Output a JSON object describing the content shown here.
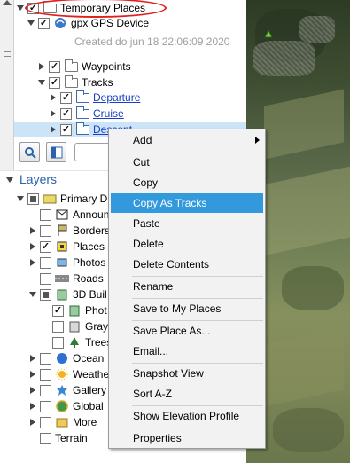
{
  "places": {
    "temporary": "Temporary Places",
    "gps_device": "gpx GPS Device",
    "created": "Created do jun 18 22:06:09 2020",
    "waypoints": "Waypoints",
    "tracks": "Tracks",
    "departure": "Departure",
    "cruise": "Cruise",
    "descent": "Descent"
  },
  "layers": {
    "title": "Layers",
    "items": [
      "Primary D",
      "Announ",
      "Borders",
      "Places",
      "Photos",
      "Roads",
      "3D Buil",
      "Phot",
      "Gray",
      "Trees",
      "Ocean",
      "Weathe",
      "Gallery",
      "Global",
      "More",
      "Terrain"
    ]
  },
  "menu": {
    "add": "Add",
    "add_mnemonic": "A",
    "add_rest": "dd",
    "cut": "Cut",
    "copy": "Copy",
    "copy_as_tracks": "Copy As Tracks",
    "paste": "Paste",
    "delete": "Delete",
    "delete_contents": "Delete Contents",
    "rename": "Rename",
    "save_to_my_places": "Save to My Places",
    "save_place_as": "Save Place As...",
    "email": "Email...",
    "snapshot_view": "Snapshot View",
    "sort_az": "Sort A-Z",
    "show_elevation_profile": "Show Elevation Profile",
    "properties": "Properties"
  },
  "colors": {
    "highlight": "#3399dd",
    "selection": "#cce4f7",
    "annotation": "#e0201b",
    "link": "#1a3fc4"
  }
}
